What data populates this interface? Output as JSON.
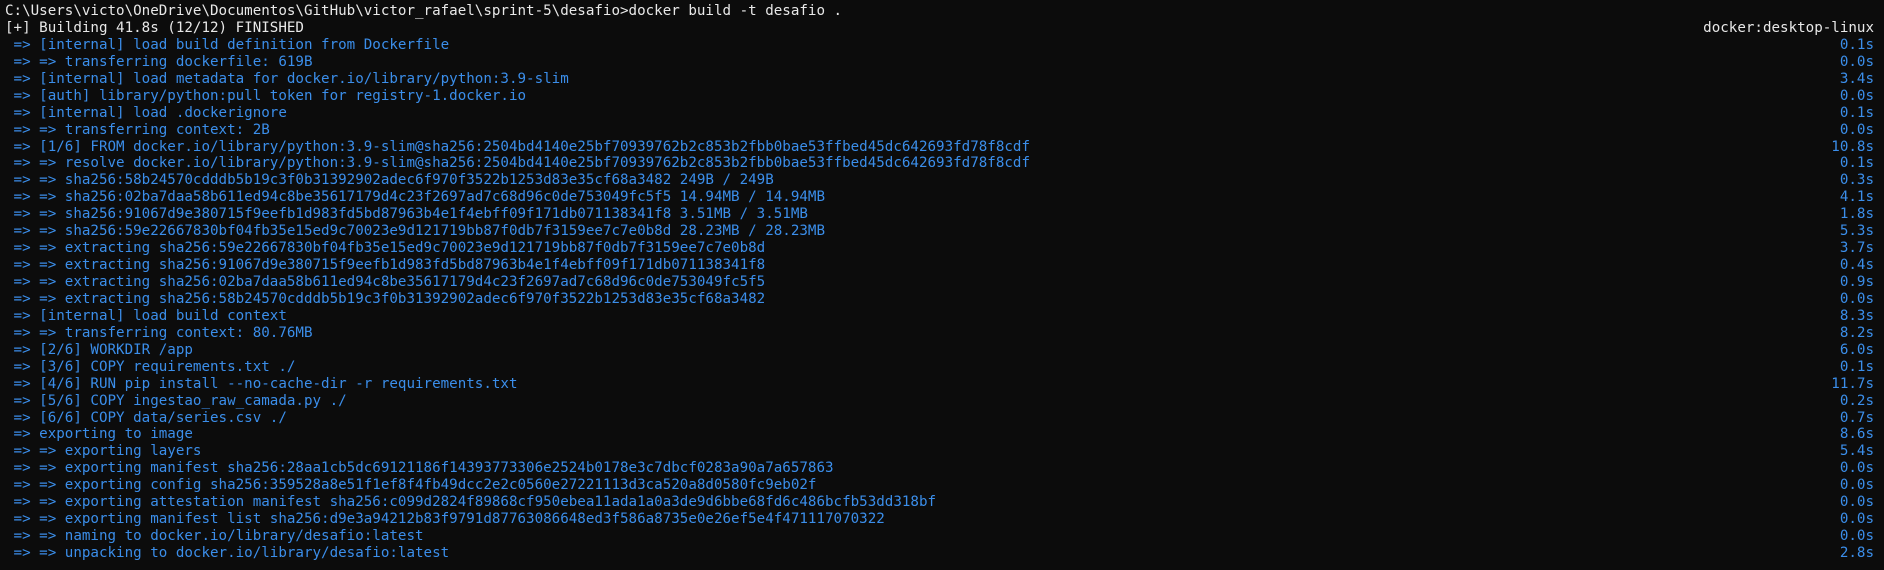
{
  "prompt": "C:\\Users\\victo\\OneDrive\\Documentos\\GitHub\\victor_rafael\\sprint-5\\desafio>docker build -t desafio .",
  "header": {
    "status": "[+] Building 41.8s (12/12) FINISHED",
    "context": "docker:desktop-linux"
  },
  "steps": [
    {
      "text": " => [internal] load build definition from Dockerfile",
      "time": "0.1s"
    },
    {
      "text": " => => transferring dockerfile: 619B",
      "time": "0.0s"
    },
    {
      "text": " => [internal] load metadata for docker.io/library/python:3.9-slim",
      "time": "3.4s"
    },
    {
      "text": " => [auth] library/python:pull token for registry-1.docker.io",
      "time": "0.0s"
    },
    {
      "text": " => [internal] load .dockerignore",
      "time": "0.1s"
    },
    {
      "text": " => => transferring context: 2B",
      "time": "0.0s"
    },
    {
      "text": " => [1/6] FROM docker.io/library/python:3.9-slim@sha256:2504bd4140e25bf70939762b2c853b2fbb0bae53ffbed45dc642693fd78f8cdf",
      "time": "10.8s"
    },
    {
      "text": " => => resolve docker.io/library/python:3.9-slim@sha256:2504bd4140e25bf70939762b2c853b2fbb0bae53ffbed45dc642693fd78f8cdf",
      "time": "0.1s"
    },
    {
      "text": " => => sha256:58b24570cdddb5b19c3f0b31392902adec6f970f3522b1253d83e35cf68a3482 249B / 249B",
      "time": "0.3s"
    },
    {
      "text": " => => sha256:02ba7daa58b611ed94c8be35617179d4c23f2697ad7c68d96c0de753049fc5f5 14.94MB / 14.94MB",
      "time": "4.1s"
    },
    {
      "text": " => => sha256:91067d9e380715f9eefb1d983fd5bd87963b4e1f4ebff09f171db071138341f8 3.51MB / 3.51MB",
      "time": "1.8s"
    },
    {
      "text": " => => sha256:59e22667830bf04fb35e15ed9c70023e9d121719bb87f0db7f3159ee7c7e0b8d 28.23MB / 28.23MB",
      "time": "5.3s"
    },
    {
      "text": " => => extracting sha256:59e22667830bf04fb35e15ed9c70023e9d121719bb87f0db7f3159ee7c7e0b8d",
      "time": "3.7s"
    },
    {
      "text": " => => extracting sha256:91067d9e380715f9eefb1d983fd5bd87963b4e1f4ebff09f171db071138341f8",
      "time": "0.4s"
    },
    {
      "text": " => => extracting sha256:02ba7daa58b611ed94c8be35617179d4c23f2697ad7c68d96c0de753049fc5f5",
      "time": "0.9s"
    },
    {
      "text": " => => extracting sha256:58b24570cdddb5b19c3f0b31392902adec6f970f3522b1253d83e35cf68a3482",
      "time": "0.0s"
    },
    {
      "text": " => [internal] load build context",
      "time": "8.3s"
    },
    {
      "text": " => => transferring context: 80.76MB",
      "time": "8.2s"
    },
    {
      "text": " => [2/6] WORKDIR /app",
      "time": "6.0s"
    },
    {
      "text": " => [3/6] COPY requirements.txt ./",
      "time": "0.1s"
    },
    {
      "text": " => [4/6] RUN pip install --no-cache-dir -r requirements.txt",
      "time": "11.7s"
    },
    {
      "text": " => [5/6] COPY ingestao_raw_camada.py ./",
      "time": "0.2s"
    },
    {
      "text": " => [6/6] COPY data/series.csv ./",
      "time": "0.7s"
    },
    {
      "text": " => exporting to image",
      "time": "8.6s"
    },
    {
      "text": " => => exporting layers",
      "time": "5.4s"
    },
    {
      "text": " => => exporting manifest sha256:28aa1cb5dc69121186f14393773306e2524b0178e3c7dbcf0283a90a7a657863",
      "time": "0.0s"
    },
    {
      "text": " => => exporting config sha256:359528a8e51f1ef8f4fb49dcc2e2c0560e27221113d3ca520a8d0580fc9eb02f",
      "time": "0.0s"
    },
    {
      "text": " => => exporting attestation manifest sha256:c099d2824f89868cf950ebea11ada1a0a3de9d6bbe68fd6c486bcfb53dd318bf",
      "time": "0.0s"
    },
    {
      "text": " => => exporting manifest list sha256:d9e3a94212b83f9791d87763086648ed3f586a8735e0e26ef5e4f471117070322",
      "time": "0.0s"
    },
    {
      "text": " => => naming to docker.io/library/desafio:latest",
      "time": "0.0s"
    },
    {
      "text": " => => unpacking to docker.io/library/desafio:latest",
      "time": "2.8s"
    }
  ]
}
